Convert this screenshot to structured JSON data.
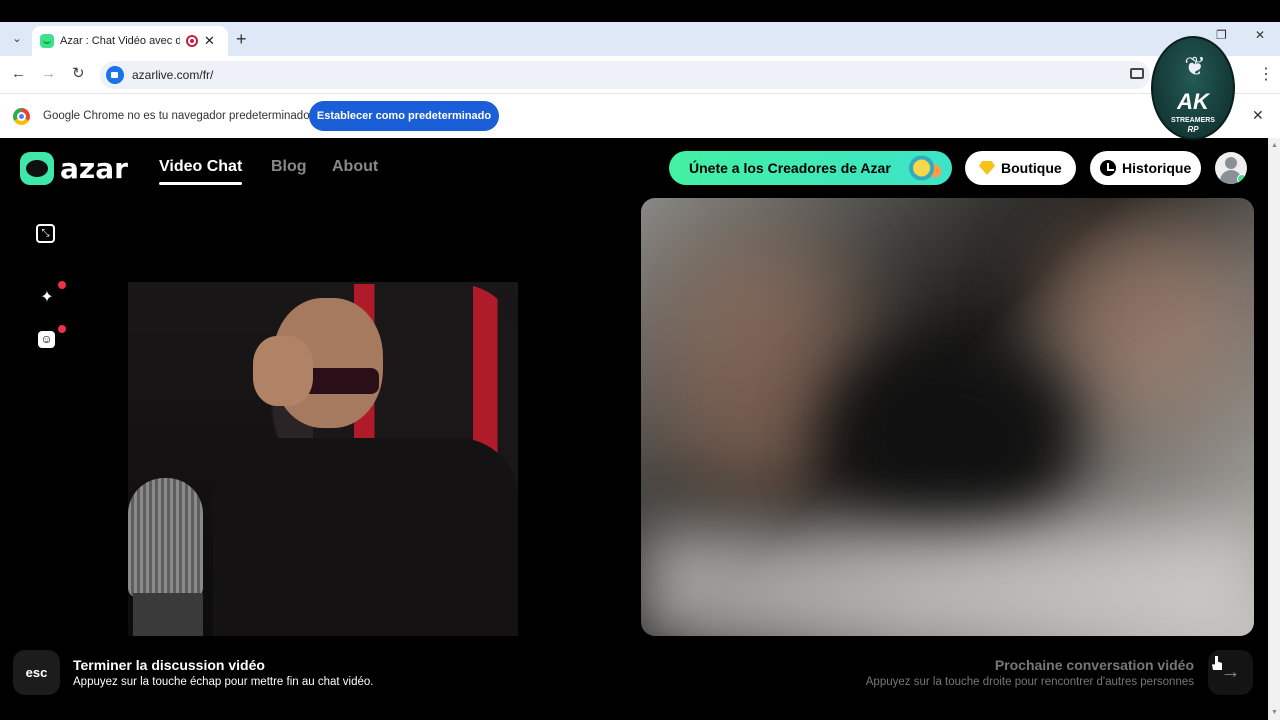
{
  "browser": {
    "tab_title": "Azar : Chat Vidéo avec de n",
    "url": "azarlive.com/fr/",
    "infobar": {
      "message": "Google Chrome no es tu navegador predeterminado",
      "button": "Establecer como predeterminado"
    }
  },
  "overlay_logo": {
    "main": "AK",
    "sub": "STREAMERS",
    "sub2": "RP"
  },
  "app": {
    "logo_text": "azar",
    "nav": [
      "Video Chat",
      "Blog",
      "About"
    ],
    "creators_button": "Únete a los Creadores de Azar",
    "boutique": "Boutique",
    "historique": "Historique"
  },
  "footer": {
    "esc_key": "esc",
    "end_title": "Terminer la discussion vidéo",
    "end_sub": "Appuyez sur la touche échap pour mettre fin au chat vidéo.",
    "next_title": "Prochaine conversation vidéo",
    "next_sub": "Appuyez sur la touche droite pour rencontrer d'autres personnes"
  },
  "colors": {
    "accent": "#3fe8a8",
    "chrome_blue": "#1a5ed8",
    "notification_red": "#e8334a"
  }
}
